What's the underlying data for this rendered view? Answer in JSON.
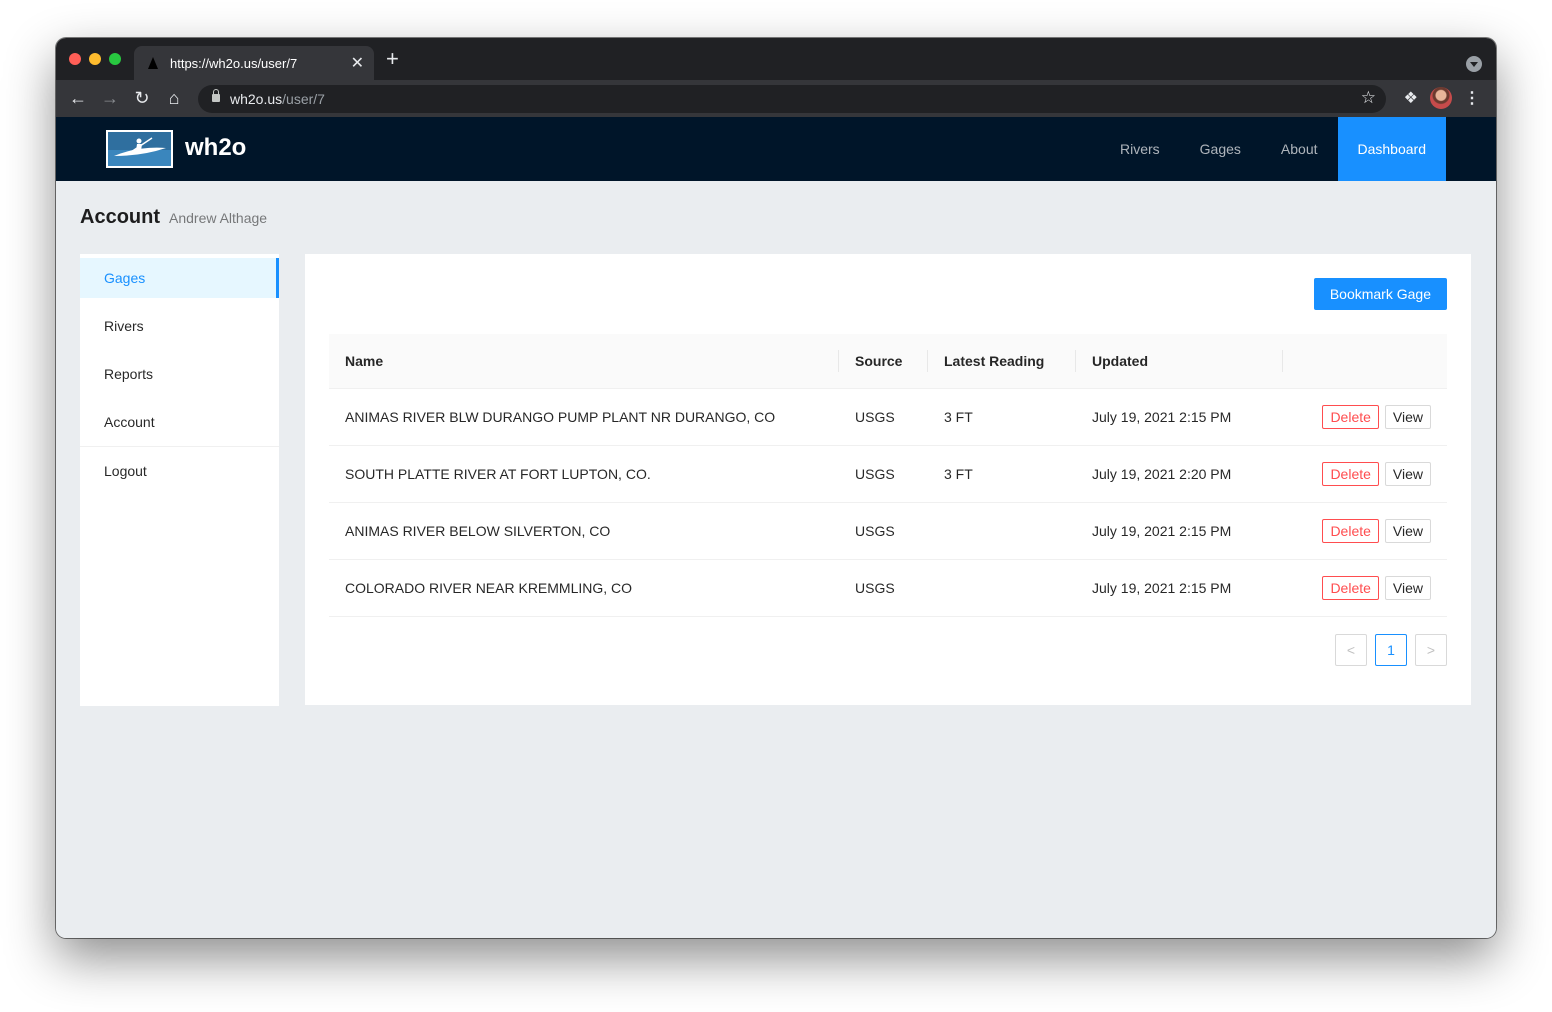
{
  "browser": {
    "tab_title": "https://wh2o.us/user/7",
    "tab_close": "✕",
    "new_tab": "+",
    "url_host": "wh2o.us",
    "url_path": "/user/7"
  },
  "app": {
    "brand": "wh2o",
    "nav": [
      "Rivers",
      "Gages",
      "About",
      "Dashboard"
    ],
    "active_nav": "Dashboard",
    "accent": "#1890ff",
    "header_bg": "#001529"
  },
  "page": {
    "title": "Account",
    "subtitle": "Andrew Althage"
  },
  "sidebar": {
    "items": [
      "Gages",
      "Rivers",
      "Reports",
      "Account"
    ],
    "active": "Gages",
    "logout": "Logout"
  },
  "content": {
    "bookmark_button": "Bookmark Gage",
    "columns": [
      "Name",
      "Source",
      "Latest Reading",
      "Updated"
    ],
    "rows": [
      {
        "name": "ANIMAS RIVER BLW DURANGO PUMP PLANT NR DURANGO, CO",
        "source": "USGS",
        "reading": "3 FT",
        "updated": "July 19, 2021 2:15 PM"
      },
      {
        "name": "SOUTH PLATTE RIVER AT FORT LUPTON, CO.",
        "source": "USGS",
        "reading": "3 FT",
        "updated": "July 19, 2021 2:20 PM"
      },
      {
        "name": "ANIMAS RIVER BELOW SILVERTON, CO",
        "source": "USGS",
        "reading": "",
        "updated": "July 19, 2021 2:15 PM"
      },
      {
        "name": "COLORADO RIVER NEAR KREMMLING, CO",
        "source": "USGS",
        "reading": "",
        "updated": "July 19, 2021 2:15 PM"
      }
    ],
    "delete_label": "Delete",
    "view_label": "View",
    "pagination": {
      "prev": "<",
      "current": "1",
      "next": ">"
    }
  }
}
